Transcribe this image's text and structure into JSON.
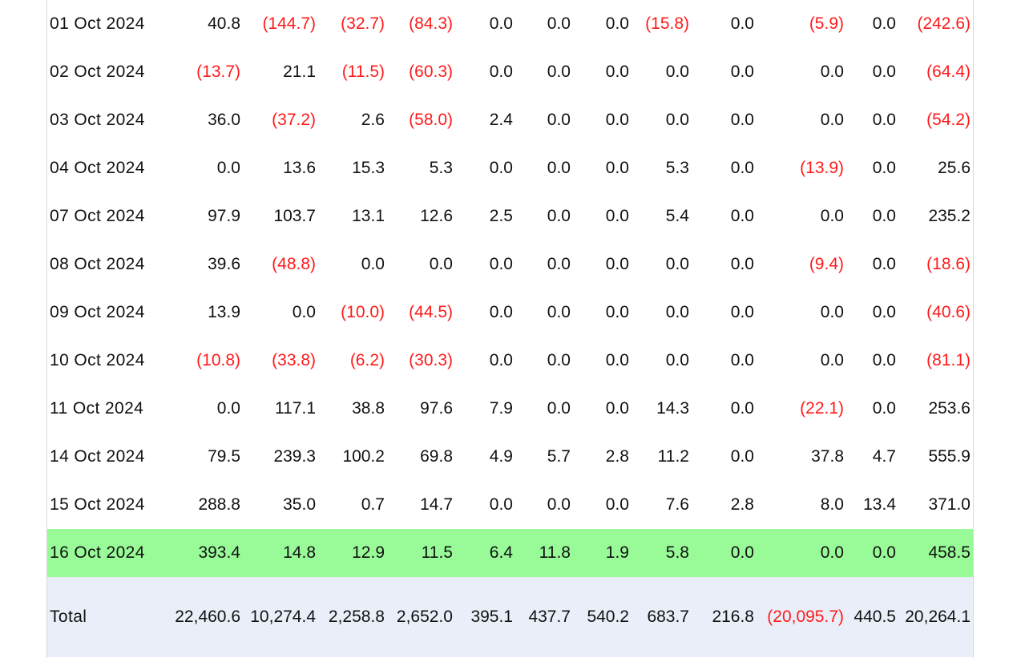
{
  "table": {
    "rows": [
      {
        "date": "01 Oct 2024",
        "cells": [
          {
            "text": "40.8",
            "neg": false
          },
          {
            "text": "(144.7)",
            "neg": true
          },
          {
            "text": "(32.7)",
            "neg": true
          },
          {
            "text": "(84.3)",
            "neg": true
          },
          {
            "text": "0.0",
            "neg": false
          },
          {
            "text": "0.0",
            "neg": false
          },
          {
            "text": "0.0",
            "neg": false
          },
          {
            "text": "(15.8)",
            "neg": true
          },
          {
            "text": "0.0",
            "neg": false
          },
          {
            "text": "(5.9)",
            "neg": true
          },
          {
            "text": "0.0",
            "neg": false
          },
          {
            "text": "(242.6)",
            "neg": true
          }
        ]
      },
      {
        "date": "02 Oct 2024",
        "cells": [
          {
            "text": "(13.7)",
            "neg": true
          },
          {
            "text": "21.1",
            "neg": false
          },
          {
            "text": "(11.5)",
            "neg": true
          },
          {
            "text": "(60.3)",
            "neg": true
          },
          {
            "text": "0.0",
            "neg": false
          },
          {
            "text": "0.0",
            "neg": false
          },
          {
            "text": "0.0",
            "neg": false
          },
          {
            "text": "0.0",
            "neg": false
          },
          {
            "text": "0.0",
            "neg": false
          },
          {
            "text": "0.0",
            "neg": false
          },
          {
            "text": "0.0",
            "neg": false
          },
          {
            "text": "(64.4)",
            "neg": true
          }
        ]
      },
      {
        "date": "03 Oct 2024",
        "cells": [
          {
            "text": "36.0",
            "neg": false
          },
          {
            "text": "(37.2)",
            "neg": true
          },
          {
            "text": "2.6",
            "neg": false
          },
          {
            "text": "(58.0)",
            "neg": true
          },
          {
            "text": "2.4",
            "neg": false
          },
          {
            "text": "0.0",
            "neg": false
          },
          {
            "text": "0.0",
            "neg": false
          },
          {
            "text": "0.0",
            "neg": false
          },
          {
            "text": "0.0",
            "neg": false
          },
          {
            "text": "0.0",
            "neg": false
          },
          {
            "text": "0.0",
            "neg": false
          },
          {
            "text": "(54.2)",
            "neg": true
          }
        ]
      },
      {
        "date": "04 Oct 2024",
        "cells": [
          {
            "text": "0.0",
            "neg": false
          },
          {
            "text": "13.6",
            "neg": false
          },
          {
            "text": "15.3",
            "neg": false
          },
          {
            "text": "5.3",
            "neg": false
          },
          {
            "text": "0.0",
            "neg": false
          },
          {
            "text": "0.0",
            "neg": false
          },
          {
            "text": "0.0",
            "neg": false
          },
          {
            "text": "5.3",
            "neg": false
          },
          {
            "text": "0.0",
            "neg": false
          },
          {
            "text": "(13.9)",
            "neg": true
          },
          {
            "text": "0.0",
            "neg": false
          },
          {
            "text": "25.6",
            "neg": false
          }
        ]
      },
      {
        "date": "07 Oct 2024",
        "cells": [
          {
            "text": "97.9",
            "neg": false
          },
          {
            "text": "103.7",
            "neg": false
          },
          {
            "text": "13.1",
            "neg": false
          },
          {
            "text": "12.6",
            "neg": false
          },
          {
            "text": "2.5",
            "neg": false
          },
          {
            "text": "0.0",
            "neg": false
          },
          {
            "text": "0.0",
            "neg": false
          },
          {
            "text": "5.4",
            "neg": false
          },
          {
            "text": "0.0",
            "neg": false
          },
          {
            "text": "0.0",
            "neg": false
          },
          {
            "text": "0.0",
            "neg": false
          },
          {
            "text": "235.2",
            "neg": false
          }
        ]
      },
      {
        "date": "08 Oct 2024",
        "cells": [
          {
            "text": "39.6",
            "neg": false
          },
          {
            "text": "(48.8)",
            "neg": true
          },
          {
            "text": "0.0",
            "neg": false
          },
          {
            "text": "0.0",
            "neg": false
          },
          {
            "text": "0.0",
            "neg": false
          },
          {
            "text": "0.0",
            "neg": false
          },
          {
            "text": "0.0",
            "neg": false
          },
          {
            "text": "0.0",
            "neg": false
          },
          {
            "text": "0.0",
            "neg": false
          },
          {
            "text": "(9.4)",
            "neg": true
          },
          {
            "text": "0.0",
            "neg": false
          },
          {
            "text": "(18.6)",
            "neg": true
          }
        ]
      },
      {
        "date": "09 Oct 2024",
        "cells": [
          {
            "text": "13.9",
            "neg": false
          },
          {
            "text": "0.0",
            "neg": false
          },
          {
            "text": "(10.0)",
            "neg": true
          },
          {
            "text": "(44.5)",
            "neg": true
          },
          {
            "text": "0.0",
            "neg": false
          },
          {
            "text": "0.0",
            "neg": false
          },
          {
            "text": "0.0",
            "neg": false
          },
          {
            "text": "0.0",
            "neg": false
          },
          {
            "text": "0.0",
            "neg": false
          },
          {
            "text": "0.0",
            "neg": false
          },
          {
            "text": "0.0",
            "neg": false
          },
          {
            "text": "(40.6)",
            "neg": true
          }
        ]
      },
      {
        "date": "10 Oct 2024",
        "cells": [
          {
            "text": "(10.8)",
            "neg": true
          },
          {
            "text": "(33.8)",
            "neg": true
          },
          {
            "text": "(6.2)",
            "neg": true
          },
          {
            "text": "(30.3)",
            "neg": true
          },
          {
            "text": "0.0",
            "neg": false
          },
          {
            "text": "0.0",
            "neg": false
          },
          {
            "text": "0.0",
            "neg": false
          },
          {
            "text": "0.0",
            "neg": false
          },
          {
            "text": "0.0",
            "neg": false
          },
          {
            "text": "0.0",
            "neg": false
          },
          {
            "text": "0.0",
            "neg": false
          },
          {
            "text": "(81.1)",
            "neg": true
          }
        ]
      },
      {
        "date": "11 Oct 2024",
        "cells": [
          {
            "text": "0.0",
            "neg": false
          },
          {
            "text": "117.1",
            "neg": false
          },
          {
            "text": "38.8",
            "neg": false
          },
          {
            "text": "97.6",
            "neg": false
          },
          {
            "text": "7.9",
            "neg": false
          },
          {
            "text": "0.0",
            "neg": false
          },
          {
            "text": "0.0",
            "neg": false
          },
          {
            "text": "14.3",
            "neg": false
          },
          {
            "text": "0.0",
            "neg": false
          },
          {
            "text": "(22.1)",
            "neg": true
          },
          {
            "text": "0.0",
            "neg": false
          },
          {
            "text": "253.6",
            "neg": false
          }
        ]
      },
      {
        "date": "14 Oct 2024",
        "cells": [
          {
            "text": "79.5",
            "neg": false
          },
          {
            "text": "239.3",
            "neg": false
          },
          {
            "text": "100.2",
            "neg": false
          },
          {
            "text": "69.8",
            "neg": false
          },
          {
            "text": "4.9",
            "neg": false
          },
          {
            "text": "5.7",
            "neg": false
          },
          {
            "text": "2.8",
            "neg": false
          },
          {
            "text": "11.2",
            "neg": false
          },
          {
            "text": "0.0",
            "neg": false
          },
          {
            "text": "37.8",
            "neg": false
          },
          {
            "text": "4.7",
            "neg": false
          },
          {
            "text": "555.9",
            "neg": false
          }
        ]
      },
      {
        "date": "15 Oct 2024",
        "cells": [
          {
            "text": "288.8",
            "neg": false
          },
          {
            "text": "35.0",
            "neg": false
          },
          {
            "text": "0.7",
            "neg": false
          },
          {
            "text": "14.7",
            "neg": false
          },
          {
            "text": "0.0",
            "neg": false
          },
          {
            "text": "0.0",
            "neg": false
          },
          {
            "text": "0.0",
            "neg": false
          },
          {
            "text": "7.6",
            "neg": false
          },
          {
            "text": "2.8",
            "neg": false
          },
          {
            "text": "8.0",
            "neg": false
          },
          {
            "text": "13.4",
            "neg": false
          },
          {
            "text": "371.0",
            "neg": false
          }
        ]
      },
      {
        "date": "16 Oct 2024",
        "highlight": true,
        "cells": [
          {
            "text": "393.4",
            "neg": false
          },
          {
            "text": "14.8",
            "neg": false
          },
          {
            "text": "12.9",
            "neg": false
          },
          {
            "text": "11.5",
            "neg": false
          },
          {
            "text": "6.4",
            "neg": false
          },
          {
            "text": "11.8",
            "neg": false
          },
          {
            "text": "1.9",
            "neg": false
          },
          {
            "text": "5.8",
            "neg": false
          },
          {
            "text": "0.0",
            "neg": false
          },
          {
            "text": "0.0",
            "neg": false
          },
          {
            "text": "0.0",
            "neg": false
          },
          {
            "text": "458.5",
            "neg": false
          }
        ]
      }
    ],
    "total": {
      "label": "Total",
      "cells": [
        {
          "text": "22,460.6",
          "neg": false
        },
        {
          "text": "10,274.4",
          "neg": false
        },
        {
          "text": "2,258.8",
          "neg": false
        },
        {
          "text": "2,652.0",
          "neg": false
        },
        {
          "text": "395.1",
          "neg": false
        },
        {
          "text": "437.7",
          "neg": false
        },
        {
          "text": "540.2",
          "neg": false
        },
        {
          "text": "683.7",
          "neg": false
        },
        {
          "text": "216.8",
          "neg": false
        },
        {
          "text": "(20,095.7)",
          "neg": true
        },
        {
          "text": "440.5",
          "neg": false
        },
        {
          "text": "20,264.1",
          "neg": false
        }
      ]
    }
  },
  "colors": {
    "negative": "#ff1a1a",
    "highlight_row": "#98fb98",
    "total_row": "#eaeef8"
  }
}
